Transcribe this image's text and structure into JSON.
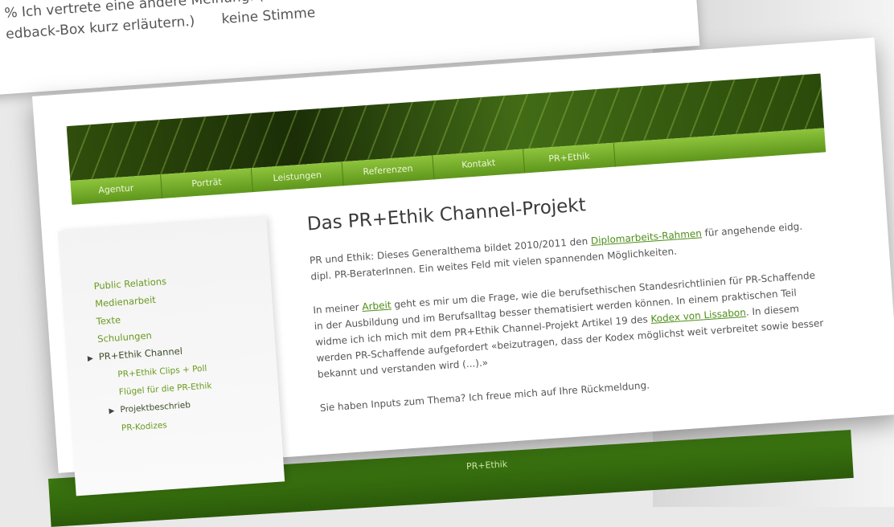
{
  "background_page": {
    "line1": "% Ich vertrete eine andere Meinung. (Danke, wenn",
    "line2": "edback-Box kurz erläutern.)",
    "option": "keine Stimme"
  },
  "nav": [
    "Agentur",
    "Porträt",
    "Leistungen",
    "Referenzen",
    "Kontakt",
    "PR+Ethik"
  ],
  "sidebar": {
    "items": [
      "Public Relations",
      "Medienarbeit",
      "Texte",
      "Schulungen",
      "PR+Ethik Channel",
      "PR+Ethik Clips + Poll",
      "Flügel für die PR-Ethik",
      "Projektbeschrieb",
      "PR-Kodizes"
    ]
  },
  "content": {
    "title": "Das PR+Ethik Channel-Projekt",
    "p1_text1": "PR und Ethik: Dieses Generalthema bildet 2010/2011 den ",
    "p1_link": "Diplomarbeits-Rahmen",
    "p1_text2": " für angehende eidg. dipl. PR-BeraterInnen. Ein weites Feld mit vielen spannenden Möglichkeiten.",
    "p2_text1": "In meiner ",
    "p2_link1": "Arbeit",
    "p2_text2": " geht es mir um die Frage, wie die berufsethischen Standesrichtlinien für PR-Schaffende in der Ausbildung und im Berufsalltag besser thematisiert werden können. In einem praktischen Teil widme ich ich mich mit dem PR+Ethik Channel-Projekt Artikel 19 des ",
    "p2_link2": "Kodex von Lissabon",
    "p2_text3": ". In diesem werden PR-Schaffende aufgefordert «beizutragen, dass der Kodex möglichst weit verbreitet sowie besser bekannt und verstanden wird (...).»",
    "p3": "Sie haben Inputs zum Thema? Ich freue mich auf Ihre Rückmeldung."
  },
  "bottom_nav": {
    "tab": "PR+Ethik"
  }
}
